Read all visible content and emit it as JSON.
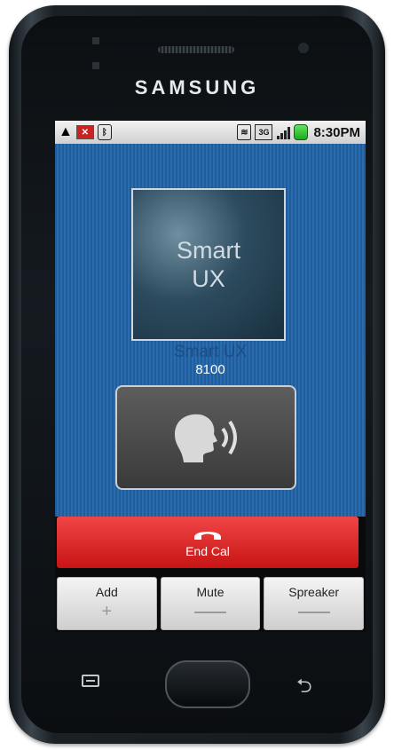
{
  "brand": "SAMSUNG",
  "status_bar": {
    "time": "8:30PM",
    "icons": [
      "warning-icon",
      "missed-call-icon",
      "bluetooth-icon",
      "wifi-icon",
      "3g-icon",
      "signal-icon",
      "battery-icon"
    ]
  },
  "call": {
    "photo_text_line1": "Smart",
    "photo_text_line2": "UX",
    "caller_name": "Smart UX",
    "caller_number": "8100"
  },
  "end_call": {
    "label": "End Cal"
  },
  "buttons": {
    "add": "Add",
    "mute": "Mute",
    "speaker": "Spreaker"
  },
  "colors": {
    "call_background": "#2a6cad",
    "end_call": "#e03232",
    "caller_name": "#1c4d85"
  }
}
